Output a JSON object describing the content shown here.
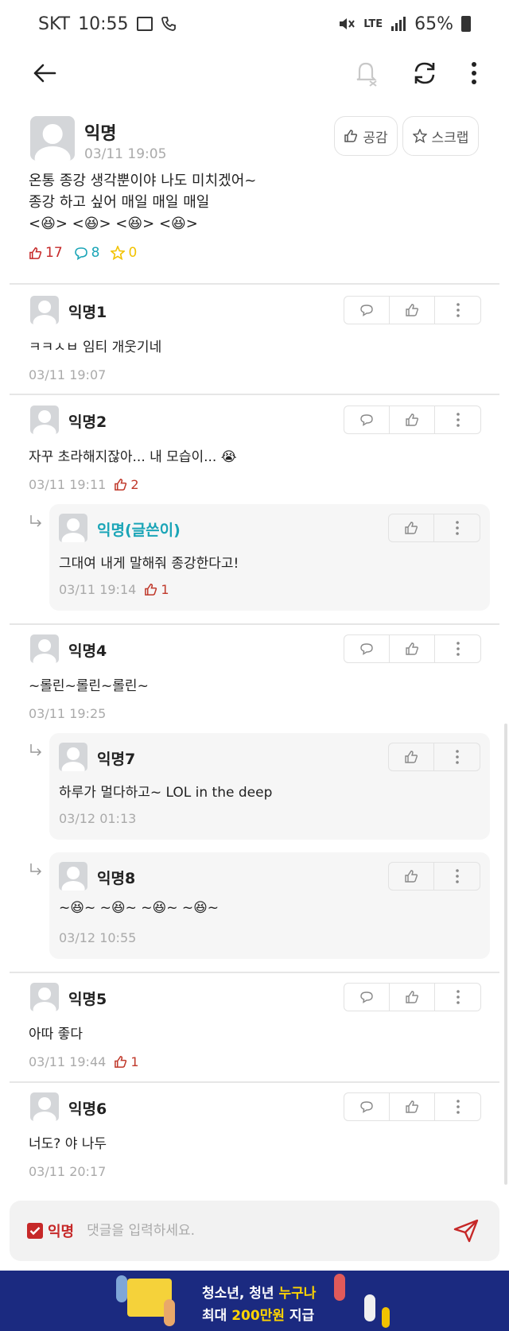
{
  "status_bar": {
    "carrier": "SKT",
    "time": "10:55",
    "network": "LTE",
    "battery": "65%"
  },
  "post": {
    "author": "익명",
    "time": "03/11 19:05",
    "empathy_label": "공감",
    "scrap_label": "스크랩",
    "body_line1": "온통 종강 생각뿐이야 나도 미치겠어~",
    "body_line2": "종강 하고 싶어 매일 매일 매일",
    "body_line3": "<😆> <😆> <😆> <😆>",
    "likes": "17",
    "comments": "8",
    "scraps": "0"
  },
  "comments": [
    {
      "name": "익명1",
      "text": "ㅋㅋㅅㅂ 임티 개웃기네",
      "time": "03/11 19:07"
    },
    {
      "name": "익명2",
      "text": "자꾸 초라해지잖아... 내 모습이... 😭",
      "time": "03/11 19:11",
      "votes": "2",
      "reply": {
        "name": "익명(글쓴이)",
        "text": "그대여 내게 말해줘 종강한다고!",
        "time": "03/11 19:14",
        "votes": "1"
      }
    },
    {
      "name": "익명4",
      "text": "~롤린~롤린~롤린~",
      "time": "03/11 19:25",
      "replies": [
        {
          "name": "익명7",
          "text": "하루가 멀다하고~ LOL in the deep",
          "time": "03/12 01:13"
        },
        {
          "name": "익명8",
          "text": "~😆~ ~😆~ ~😆~ ~😆~",
          "time": "03/12 10:55"
        }
      ]
    },
    {
      "name": "익명5",
      "text": "아따 좋다",
      "time": "03/11 19:44",
      "votes": "1"
    },
    {
      "name": "익명6",
      "text": "너도? 야 나두",
      "time": "03/11 20:17"
    }
  ],
  "comment_bar": {
    "anon_label": "익명",
    "placeholder": "댓글을 입력하세요."
  },
  "banner": {
    "line1_a": "청소년, 청년 ",
    "line1_b": "누구나",
    "line2_a": "최대 ",
    "line2_b": "200만원",
    "line2_c": " 지급"
  },
  "colors": {
    "accent_red": "#c62828",
    "author_teal": "#1ba5b7",
    "comment_blue": "#1ba5b7",
    "scrap_yellow": "#f2c200",
    "banner_navy": "#1b2a80"
  }
}
